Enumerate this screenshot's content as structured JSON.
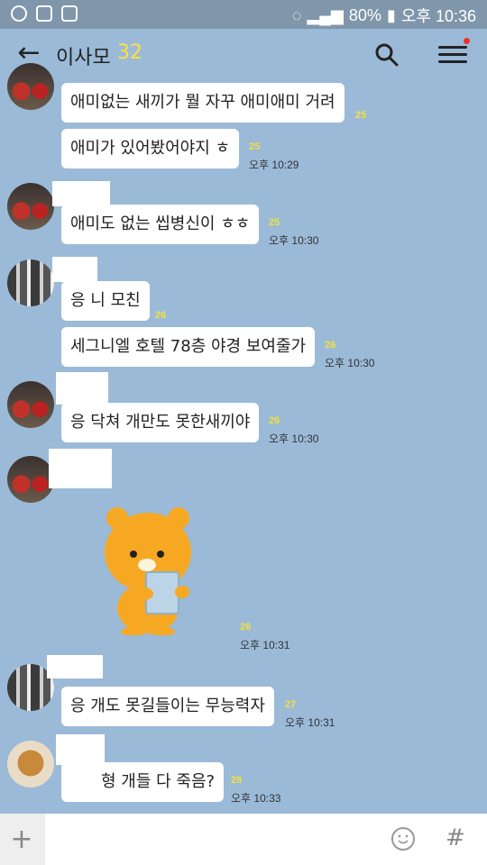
{
  "status_bar": {
    "battery": "80%",
    "time": "오후 10:36"
  },
  "header": {
    "title": "이사모",
    "member_count": "32"
  },
  "messages": [
    {
      "text": "애미없는 새끼가 뭘 자꾸 애미애미 거려",
      "unread": "25",
      "time": ""
    },
    {
      "text": "애미가 있어봤어야지 ㅎ",
      "unread": "25",
      "time": "오후 10:29"
    },
    {
      "text": "애미도 없는 씹병신이 ㅎㅎ",
      "unread": "25",
      "time": "오후 10:30"
    },
    {
      "text": "응 니 모친",
      "unread": "26",
      "time": ""
    },
    {
      "text": "세그니엘 호텔 78층 야경 보여줄가",
      "unread": "26",
      "time": "오후 10:30"
    },
    {
      "text": "응 닥쳐 개만도 못한새끼야",
      "unread": "26",
      "time": "오후 10:30"
    },
    {
      "text": "",
      "unread": "26",
      "time": "오후 10:31"
    },
    {
      "text": "응 개도 못길들이는 무능력자",
      "unread": "27",
      "time": "오후 10:31"
    },
    {
      "text": "형 개들 다 죽음?",
      "unread": "28",
      "time": "오후 10:33"
    }
  ],
  "icons": {
    "back": "arrow-left-icon",
    "search": "search-icon",
    "menu": "menu-icon",
    "plus": "plus-icon",
    "emoji": "emoji-icon",
    "hash": "hash-icon"
  },
  "colors": {
    "chat_bg": "#9bbad8",
    "unread": "#f2e13a",
    "notification_dot": "#f0302a"
  }
}
